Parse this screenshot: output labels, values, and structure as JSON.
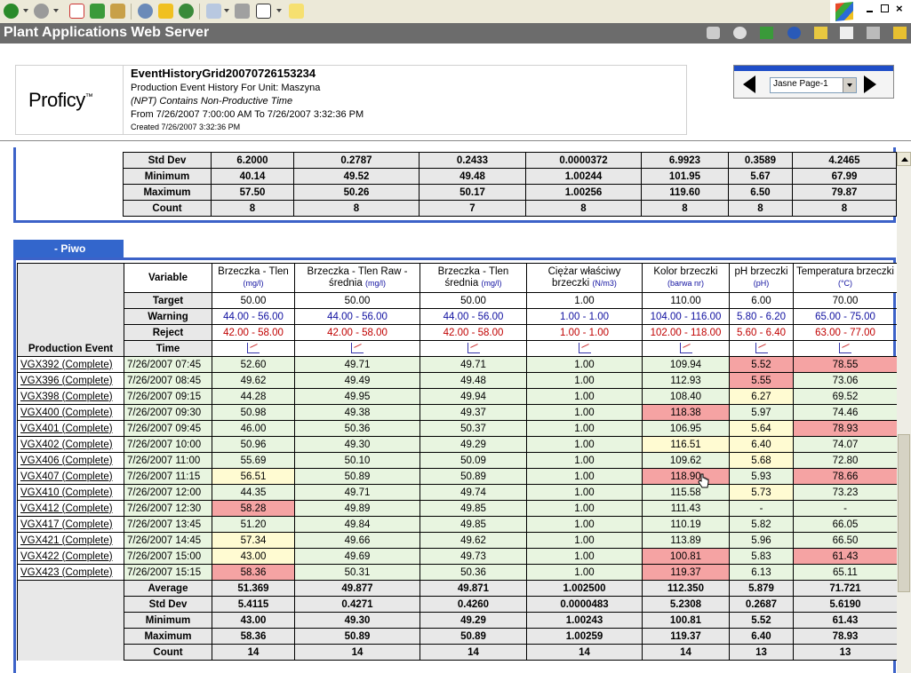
{
  "app": {
    "title": "Plant Applications Web Server"
  },
  "header": {
    "logo_text": "Proficy",
    "logo_tm": "™",
    "report_name": "EventHistoryGrid20070726153234",
    "report_title": "Production Event History For Unit: Maszyna",
    "npt_note": "(NPT) Contains Non-Productive Time",
    "range": "From 7/26/2007 7:00:00 AM To 7/26/2007 3:32:36 PM",
    "created": "Created 7/26/2007 3:32:36 PM"
  },
  "nav": {
    "page_select": "Jasne Page-1"
  },
  "top_stats": [
    {
      "label": "Std Dev",
      "values": [
        "6.2000",
        "0.2787",
        "0.2433",
        "0.0000372",
        "6.9923",
        "0.3589",
        "4.2465"
      ]
    },
    {
      "label": "Minimum",
      "values": [
        "40.14",
        "49.52",
        "49.48",
        "1.00244",
        "101.95",
        "5.67",
        "67.99"
      ]
    },
    {
      "label": "Maximum",
      "values": [
        "57.50",
        "50.26",
        "50.17",
        "1.00256",
        "119.60",
        "6.50",
        "79.87"
      ]
    },
    {
      "label": "Count",
      "values": [
        "8",
        "8",
        "7",
        "8",
        "8",
        "8",
        "8"
      ]
    }
  ],
  "piwo": {
    "tab_label": "- Piwo",
    "variable_label": "Variable",
    "target_label": "Target",
    "warning_label": "Warning",
    "reject_label": "Reject",
    "time_label": "Time",
    "event_label": "Production Event",
    "columns": [
      {
        "name": "Brzeczka - Tlen",
        "unit": "(mg/l)",
        "target": "50.00",
        "warning": "44.00 - 56.00",
        "reject": "42.00 - 58.00"
      },
      {
        "name": "Brzeczka - Tlen Raw - średnia",
        "unit": "(mg/l)",
        "target": "50.00",
        "warning": "44.00 - 56.00",
        "reject": "42.00 - 58.00"
      },
      {
        "name": "Brzeczka - Tlen średnia",
        "unit": "(mg/l)",
        "target": "50.00",
        "warning": "44.00 - 56.00",
        "reject": "42.00 - 58.00"
      },
      {
        "name": "Ciężar właściwy brzeczki",
        "unit": "(N/m3)",
        "target": "1.00",
        "warning": "1.00 - 1.00",
        "reject": "1.00 - 1.00"
      },
      {
        "name": "Kolor brzeczki",
        "unit": "(barwa nr)",
        "target": "110.00",
        "warning": "104.00 - 116.00",
        "reject": "102.00 - 118.00"
      },
      {
        "name": "pH brzeczki",
        "unit": "(pH)",
        "target": "6.00",
        "warning": "5.80 - 6.20",
        "reject": "5.60 - 6.40"
      },
      {
        "name": "Temperatura brzeczki",
        "unit": "(°C)",
        "target": "70.00",
        "warning": "65.00 - 75.00",
        "reject": "63.00 - 77.00"
      }
    ],
    "rows": [
      {
        "event": "VGX392 (Complete)",
        "time": "7/26/2007 07:45",
        "values": [
          "52.60",
          "49.71",
          "49.71",
          "1.00",
          "109.94",
          "5.52",
          "78.55"
        ],
        "status": [
          "ok",
          "ok",
          "ok",
          "ok",
          "ok",
          "rej",
          "rej"
        ]
      },
      {
        "event": "VGX396 (Complete)",
        "time": "7/26/2007 08:45",
        "values": [
          "49.62",
          "49.49",
          "49.48",
          "1.00",
          "112.93",
          "5.55",
          "73.06"
        ],
        "status": [
          "ok",
          "ok",
          "ok",
          "ok",
          "ok",
          "rej",
          "ok"
        ]
      },
      {
        "event": "VGX398 (Complete)",
        "time": "7/26/2007 09:15",
        "values": [
          "44.28",
          "49.95",
          "49.94",
          "1.00",
          "108.40",
          "6.27",
          "69.52"
        ],
        "status": [
          "ok",
          "ok",
          "ok",
          "ok",
          "ok",
          "warn",
          "ok"
        ]
      },
      {
        "event": "VGX400 (Complete)",
        "time": "7/26/2007 09:30",
        "values": [
          "50.98",
          "49.38",
          "49.37",
          "1.00",
          "118.38",
          "5.97",
          "74.46"
        ],
        "status": [
          "ok",
          "ok",
          "ok",
          "ok",
          "rej",
          "ok",
          "ok"
        ]
      },
      {
        "event": "VGX401 (Complete)",
        "time": "7/26/2007 09:45",
        "values": [
          "46.00",
          "50.36",
          "50.37",
          "1.00",
          "106.95",
          "5.64",
          "78.93"
        ],
        "status": [
          "ok",
          "ok",
          "ok",
          "ok",
          "ok",
          "warn",
          "rej"
        ]
      },
      {
        "event": "VGX402 (Complete)",
        "time": "7/26/2007 10:00",
        "values": [
          "50.96",
          "49.30",
          "49.29",
          "1.00",
          "116.51",
          "6.40",
          "74.07"
        ],
        "status": [
          "ok",
          "ok",
          "ok",
          "ok",
          "warn",
          "warn",
          "ok"
        ]
      },
      {
        "event": "VGX406 (Complete)",
        "time": "7/26/2007 11:00",
        "values": [
          "55.69",
          "50.10",
          "50.09",
          "1.00",
          "109.62",
          "5.68",
          "72.80"
        ],
        "status": [
          "ok",
          "ok",
          "ok",
          "ok",
          "ok",
          "warn",
          "ok"
        ]
      },
      {
        "event": "VGX407 (Complete)",
        "time": "7/26/2007 11:15",
        "values": [
          "56.51",
          "50.89",
          "50.89",
          "1.00",
          "118.90",
          "5.93",
          "78.66"
        ],
        "status": [
          "warn",
          "ok",
          "ok",
          "ok",
          "rej",
          "ok",
          "rej"
        ]
      },
      {
        "event": "VGX410 (Complete)",
        "time": "7/26/2007 12:00",
        "values": [
          "44.35",
          "49.71",
          "49.74",
          "1.00",
          "115.58",
          "5.73",
          "73.23"
        ],
        "status": [
          "ok",
          "ok",
          "ok",
          "ok",
          "ok",
          "warn",
          "ok"
        ]
      },
      {
        "event": "VGX412 (Complete)",
        "time": "7/26/2007 12:30",
        "values": [
          "58.28",
          "49.89",
          "49.85",
          "1.00",
          "111.43",
          "-",
          "-"
        ],
        "status": [
          "rej",
          "ok",
          "ok",
          "ok",
          "ok",
          "ok",
          "ok"
        ]
      },
      {
        "event": "VGX417 (Complete)",
        "time": "7/26/2007 13:45",
        "values": [
          "51.20",
          "49.84",
          "49.85",
          "1.00",
          "110.19",
          "5.82",
          "66.05"
        ],
        "status": [
          "ok",
          "ok",
          "ok",
          "ok",
          "ok",
          "ok",
          "ok"
        ]
      },
      {
        "event": "VGX421 (Complete)",
        "time": "7/26/2007 14:45",
        "values": [
          "57.34",
          "49.66",
          "49.62",
          "1.00",
          "113.89",
          "5.96",
          "66.50"
        ],
        "status": [
          "warn",
          "ok",
          "ok",
          "ok",
          "ok",
          "ok",
          "ok"
        ]
      },
      {
        "event": "VGX422 (Complete)",
        "time": "7/26/2007 15:00",
        "values": [
          "43.00",
          "49.69",
          "49.73",
          "1.00",
          "100.81",
          "5.83",
          "61.43"
        ],
        "status": [
          "warn",
          "ok",
          "ok",
          "ok",
          "rej",
          "ok",
          "rej"
        ]
      },
      {
        "event": "VGX423 (Complete)",
        "time": "7/26/2007 15:15",
        "values": [
          "58.36",
          "50.31",
          "50.36",
          "1.00",
          "119.37",
          "6.13",
          "65.11"
        ],
        "status": [
          "rej",
          "ok",
          "ok",
          "ok",
          "rej",
          "ok",
          "ok"
        ]
      }
    ],
    "stats": [
      {
        "label": "Average",
        "values": [
          "51.369",
          "49.877",
          "49.871",
          "1.002500",
          "112.350",
          "5.879",
          "71.721"
        ]
      },
      {
        "label": "Std Dev",
        "values": [
          "5.4115",
          "0.4271",
          "0.4260",
          "0.0000483",
          "5.2308",
          "0.2687",
          "5.6190"
        ]
      },
      {
        "label": "Minimum",
        "values": [
          "43.00",
          "49.30",
          "49.29",
          "1.00243",
          "100.81",
          "5.52",
          "61.43"
        ]
      },
      {
        "label": "Maximum",
        "values": [
          "58.36",
          "50.89",
          "50.89",
          "1.00259",
          "119.37",
          "6.40",
          "78.93"
        ]
      },
      {
        "label": "Count",
        "values": [
          "14",
          "14",
          "14",
          "14",
          "14",
          "13",
          "13"
        ]
      }
    ]
  },
  "colors": {
    "reject": "#f5a3a3",
    "warning": "#fffbd2",
    "ok": "#e8f5e0",
    "accent": "#3366cc"
  }
}
